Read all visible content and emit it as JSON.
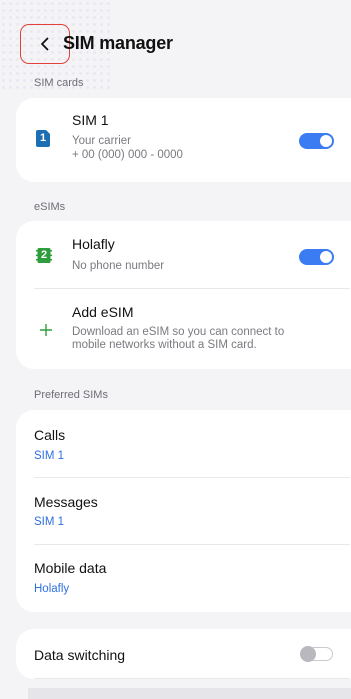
{
  "header": {
    "title": "SIM manager"
  },
  "sections": {
    "sim_cards": "SIM cards",
    "esims": "eSIMs",
    "preferred": "Preferred SIMs"
  },
  "sim1": {
    "badge": "1",
    "name": "SIM 1",
    "carrier": "Your carrier",
    "number": "+ 00 (000) 000 - 0000",
    "enabled": true
  },
  "holafly": {
    "badge": "2",
    "name": "Holafly",
    "sub": "No phone number",
    "enabled": true
  },
  "add_esim": {
    "title": "Add eSIM",
    "sub1": "Download an eSIM so you can connect to",
    "sub2": "mobile networks without a SIM card."
  },
  "preferred": {
    "calls": {
      "label": "Calls",
      "value": "SIM 1"
    },
    "messages": {
      "label": "Messages",
      "value": "SIM 1"
    },
    "mobile_data": {
      "label": "Mobile data",
      "value": "Holafly"
    }
  },
  "data_switching": {
    "label": "Data switching",
    "enabled": false
  },
  "colors": {
    "accent": "#3b7cf3",
    "link": "#2f6fe0",
    "sim1_icon": "#1c6fb3",
    "esim_icon": "#2e9e3d",
    "highlight": "#e2413b"
  },
  "icons": {
    "back": "chevron-left-icon",
    "sim1": "sim-card-icon",
    "esim": "esim-chip-icon",
    "add": "plus-icon"
  }
}
